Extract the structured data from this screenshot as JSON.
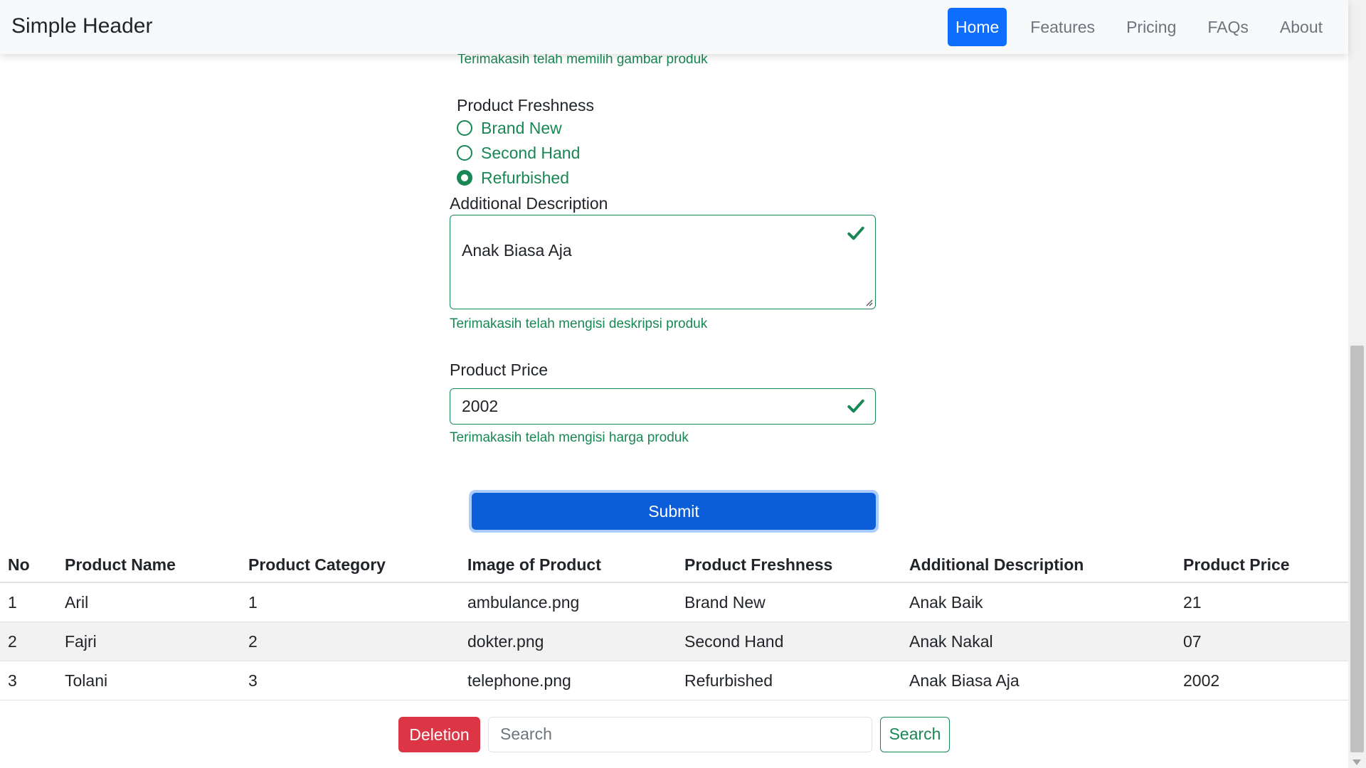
{
  "header": {
    "brand": "Simple Header",
    "nav": [
      {
        "label": "Home",
        "active": true
      },
      {
        "label": "Features"
      },
      {
        "label": "Pricing"
      },
      {
        "label": "FAQs"
      },
      {
        "label": "About"
      }
    ],
    "accent_color": "#0d6efd"
  },
  "form": {
    "image_feedback": "Terimakasih telah memilih gambar produk",
    "freshness": {
      "label": "Product Freshness",
      "options": [
        "Brand New",
        "Second Hand",
        "Refurbished"
      ],
      "selected": "Refurbished"
    },
    "description": {
      "label": "Additional Description",
      "value": "Anak Biasa Aja",
      "feedback": "Terimakasih telah mengisi deskripsi produk"
    },
    "price": {
      "label": "Product Price",
      "value": "2002",
      "feedback": "Terimakasih telah mengisi harga produk"
    },
    "submit_label": "Submit",
    "valid_color": "#198754"
  },
  "table": {
    "headers": [
      "No",
      "Product Name",
      "Product Category",
      "Image of Product",
      "Product Freshness",
      "Additional Description",
      "Product Price"
    ],
    "rows": [
      [
        "1",
        "Aril",
        "1",
        "ambulance.png",
        "Brand New",
        "Anak Baik",
        "21"
      ],
      [
        "2",
        "Fajri",
        "2",
        "dokter.png",
        "Second Hand",
        "Anak Nakal",
        "07"
      ],
      [
        "3",
        "Tolani",
        "3",
        "telephone.png",
        "Refurbished",
        "Anak Biasa Aja",
        "2002"
      ]
    ]
  },
  "controls": {
    "delete_label": "Deletion",
    "search_placeholder": "Search",
    "search_button": "Search",
    "danger_color": "#dc3545"
  }
}
